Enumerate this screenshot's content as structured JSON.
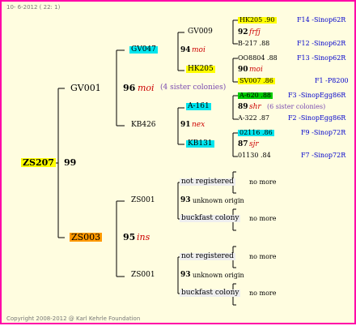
{
  "header": {
    "date_line": "10- 6-2012 ( 22: 1)"
  },
  "footer": {
    "copyright": "Copyright 2008-2012 @ Karl Kehrle Foundation"
  },
  "colors": {
    "border": "#ff00a8",
    "background": "#fffde0",
    "yellow": "#ffff00",
    "cyan": "#00e5ee",
    "orange": "#ff9900",
    "green": "#00cc00"
  },
  "root": {
    "id": "ZS207",
    "year": "99"
  },
  "gen1": {
    "upper": {
      "id": "GV001",
      "year": "96",
      "mark": "moi",
      "note": "(4 sister colonies)"
    },
    "lower": {
      "id": "ZS003",
      "year": "95",
      "mark": "ins"
    }
  },
  "gen2": {
    "gv047": {
      "id": "GV047",
      "year": "94",
      "mark": "moi"
    },
    "kb426": {
      "id": "KB426",
      "year": "91",
      "mark": "nex"
    },
    "zs001a": {
      "id": "ZS001",
      "year": "93",
      "mark": "unknown origin"
    },
    "zs001b": {
      "id": "ZS001",
      "year": "93",
      "mark": "unknown origin"
    }
  },
  "gen3": {
    "gv009": {
      "id": "GV009"
    },
    "hk205": {
      "id": "HK205"
    },
    "a161": {
      "id": "A-161",
      "year": "89",
      "mark": "shr",
      "note": "(6 sister colonies)"
    },
    "kb131": {
      "id": "KB131",
      "year": "87",
      "mark": "sjr"
    },
    "nr1": {
      "label": "not registered",
      "more": "no more"
    },
    "bf1": {
      "label": "buckfast colony",
      "more": "no more"
    },
    "nr2": {
      "label": "not registered",
      "more": "no more"
    },
    "bf2": {
      "label": "buckfast colony",
      "more": "no more"
    },
    "gv009_year": "92",
    "gv009_mark": "frfj",
    "hk205_year": "90",
    "hk205_mark": "moi"
  },
  "gen4": {
    "hk205_90": {
      "label": "HK205 .90",
      "code": "F14 -Sinop62R"
    },
    "b217": {
      "label": "B-217 .88",
      "code": "F12 -Sinop62R"
    },
    "oo8804": {
      "label": "OO8804 .88",
      "code": "F13 -Sinop62R"
    },
    "sv007": {
      "label": "SV007 .86",
      "code": "F1 -P8200"
    },
    "a620": {
      "label": "A-620 .88",
      "code": "F3 -SinopEgg86R"
    },
    "a322": {
      "label": "A-322 .87",
      "code": "F2 -SinopEgg86R"
    },
    "n02116": {
      "label": "02116 .86",
      "code": "F9 -Sinop72R"
    },
    "n01130": {
      "label": "01130 .84",
      "code": "F7 -Sinop72R"
    }
  }
}
